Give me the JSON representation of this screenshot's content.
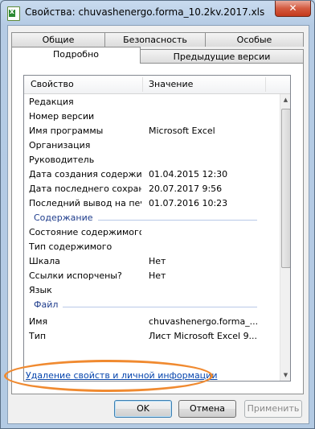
{
  "window": {
    "title": "Свойства: chuvashenergo.forma_10.2kv.2017.xls",
    "close_glyph": "✕"
  },
  "tabs": {
    "row1": [
      "Общие",
      "Безопасность",
      "Особые"
    ],
    "row2": [
      "Подробно",
      "Предыдущие версии"
    ],
    "active": "Подробно"
  },
  "list": {
    "header": {
      "property": "Свойство",
      "value": "Значение"
    },
    "rows_before": [
      {
        "name": "Редакция",
        "value": ""
      },
      {
        "name": "Номер версии",
        "value": ""
      },
      {
        "name": "Имя программы",
        "value": "Microsoft Excel"
      },
      {
        "name": "Организация",
        "value": ""
      },
      {
        "name": "Руководитель",
        "value": ""
      },
      {
        "name": "Дата создания содержи...",
        "value": "01.04.2015 12:30"
      },
      {
        "name": "Дата последнего сохран...",
        "value": "20.07.2017 9:56"
      },
      {
        "name": "Последний вывод на печ...",
        "value": "01.07.2016 10:23"
      }
    ],
    "group_content": "Содержание",
    "rows_content": [
      {
        "name": "Состояние содержимого",
        "value": ""
      },
      {
        "name": "Тип содержимого",
        "value": ""
      },
      {
        "name": "Шкала",
        "value": "Нет"
      },
      {
        "name": "Ссылки испорчены?",
        "value": "Нет"
      },
      {
        "name": "Язык",
        "value": ""
      }
    ],
    "group_file": "Файл",
    "rows_file": [
      {
        "name": "Имя",
        "value": "chuvashenergo.forma_..."
      },
      {
        "name": "Тип",
        "value": "Лист Microsoft Excel 9..."
      }
    ]
  },
  "link": {
    "remove_properties": "Удаление свойств и личной информации"
  },
  "buttons": {
    "ok": "OK",
    "cancel": "Отмена",
    "apply": "Применить"
  },
  "colors": {
    "highlight": "#f08a30",
    "group_heading": "#1e3c8c",
    "link": "#0645ad"
  }
}
